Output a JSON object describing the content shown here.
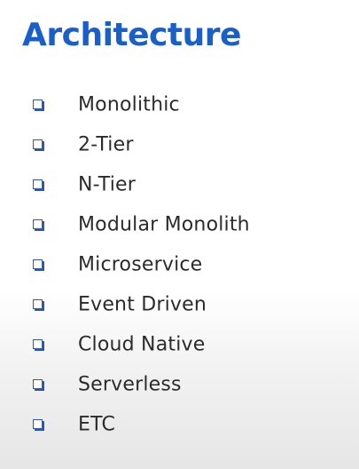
{
  "slide": {
    "title": "Architecture",
    "accent_color": "#1a5fc9",
    "bullet_icon": "square-bullet-icon",
    "items": [
      {
        "label": "Monolithic"
      },
      {
        "label": "2-Tier"
      },
      {
        "label": "N-Tier"
      },
      {
        "label": "Modular Monolith"
      },
      {
        "label": "Microservice"
      },
      {
        "label": "Event Driven"
      },
      {
        "label": "Cloud Native"
      },
      {
        "label": "Serverless"
      },
      {
        "label": "ETC"
      }
    ]
  }
}
